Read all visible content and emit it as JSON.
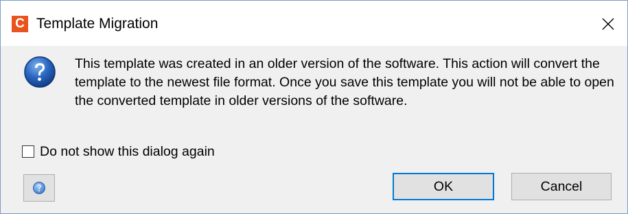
{
  "window": {
    "title": "Template Migration",
    "app_icon_letter": "C",
    "app_icon_color": "#e8541e",
    "close_icon": "close-icon"
  },
  "dialog": {
    "message": "This template was created in an older version of the software. This action will convert the template to the newest file format. Once you save this template you will not be able to open the converted template in older versions of the software.",
    "icon": "question-icon",
    "checkbox": {
      "label": "Do not show this dialog again",
      "checked": false
    },
    "help_icon": "help-icon",
    "buttons": {
      "ok_label": "OK",
      "cancel_label": "Cancel"
    },
    "accent_color": "#0078d7"
  }
}
